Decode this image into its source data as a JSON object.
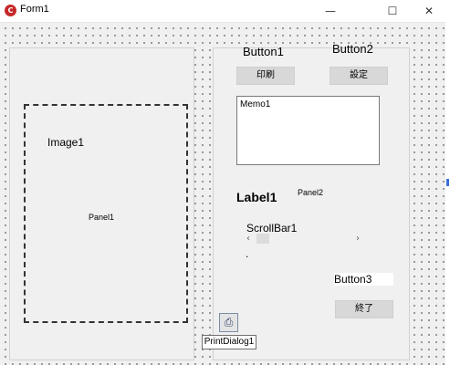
{
  "window": {
    "title": "Form1",
    "icon_glyph": "C",
    "minimize_glyph": "—",
    "maximize_glyph": "☐",
    "close_glyph": "✕"
  },
  "panel_left": {
    "image_caption": "Image1",
    "panel_caption": "Panel1"
  },
  "panel_right": {
    "button1_caption": "Button1",
    "button1_text": "印刷",
    "button2_caption": "Button2",
    "button2_text": "設定",
    "memo_text": "Memo1",
    "label_text": "Label1",
    "panel_caption": "Panel2",
    "scrollbar_caption": "ScrollBar1",
    "scroll_left": "‹",
    "scroll_right": "›",
    "dot": ".",
    "button3_caption": "Button3",
    "button3_text": "終了"
  },
  "components": {
    "print_dialog_icon": "printer-icon",
    "print_dialog_glyph": "⎙",
    "print_dialog_caption": "PrintDialog1"
  }
}
